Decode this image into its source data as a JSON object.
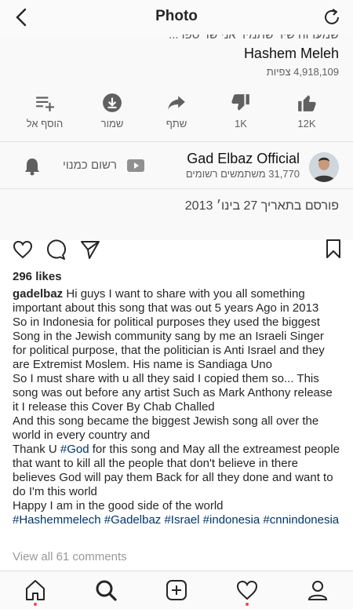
{
  "header": {
    "title": "Photo"
  },
  "video": {
    "cut_line": "שמעו זה שיר שתמיד אני שר ספר...",
    "title": "Hashem Meleh",
    "views": "4,918,109 צפיות",
    "actions": [
      {
        "label": "12K",
        "icon": "thumbs-up-icon"
      },
      {
        "label": "1K",
        "icon": "thumbs-down-icon"
      },
      {
        "label": "שתף",
        "icon": "share-icon"
      },
      {
        "label": "שמור",
        "icon": "download-icon"
      },
      {
        "label": "הוסף אל",
        "icon": "add-to-playlist-icon"
      }
    ],
    "channel": {
      "name": "Gad Elbaz Official",
      "subscribers": "31,770 משתמשים רשומים",
      "subscribe_label": "רשום כמנוי"
    },
    "published": "פורסם בתאריך 27 בינו׳ 2013"
  },
  "post": {
    "likes": "296 likes",
    "username": "gadelbaz",
    "caption": [
      "Hi guys I want to share with you all something important about this song that was out 5 years Ago in 2013",
      "So in Indonesia for political purposes they used the biggest Song in the Jewish community sang by me an Israeli Singer for political purpose, that the politician is Anti Israel and they are Extremist Moslem. His name is Sandiaga Uno",
      "So I must share with u all they said I copied them so... This song was out before any artist Such as Mark Anthony release it I release this Cover By Chab Challed",
      "And this song became the biggest Jewish song all over the world in every country and"
    ],
    "thanks_pre": "Thank U ",
    "thanks_tag": "#God",
    "thanks_post": " for this song and May all the extreamest people that want to kill all the people that don't believe in there believes God will pay them Back for all they done and want to do I'm this world",
    "happy": "Happy I am in the good side of the world",
    "hashtags": [
      "#Hashemmelech",
      "#Gadelbaz",
      "#Israel",
      "#indonesia",
      "#cnnindonesia"
    ],
    "view_all": "View all 61 comments"
  },
  "colors": {
    "link": "#003569",
    "notification_dot": "#ed4956"
  }
}
